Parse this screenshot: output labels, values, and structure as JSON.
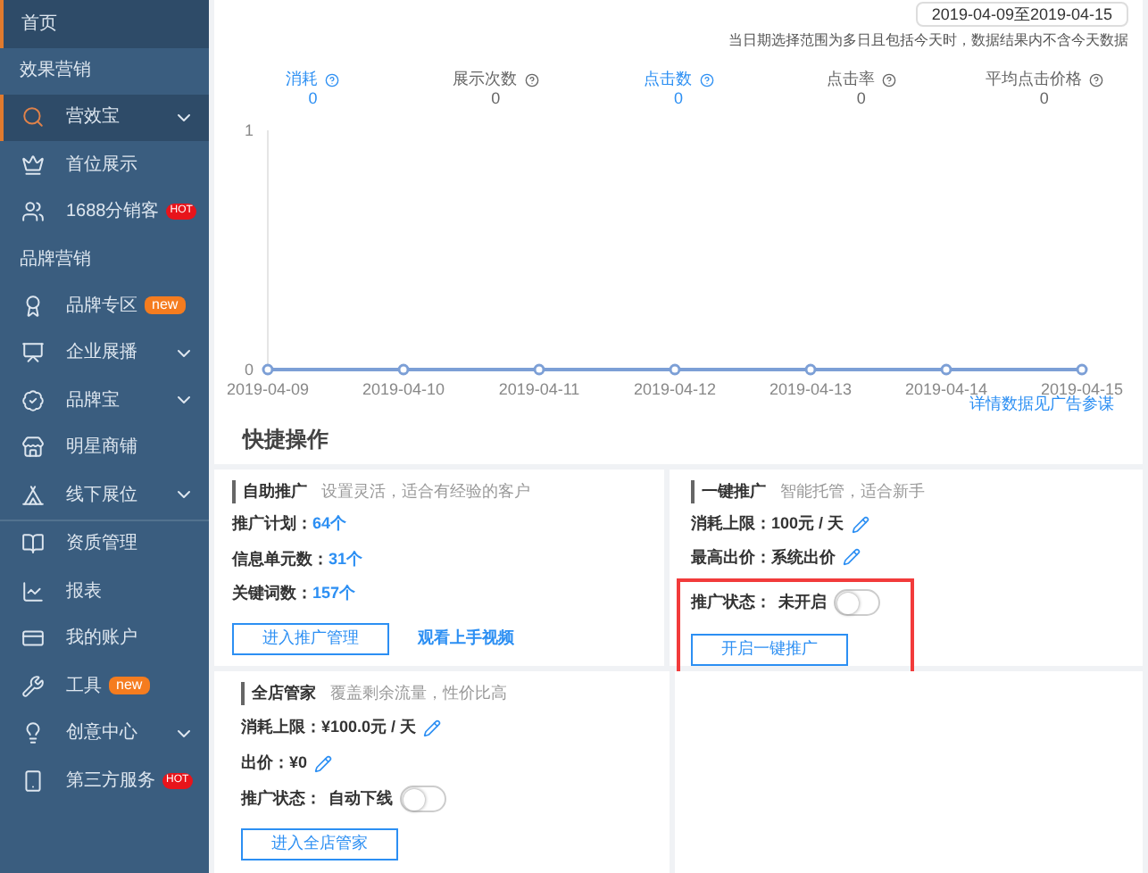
{
  "sidebar": {
    "items": [
      {
        "kind": "item",
        "label": "首页",
        "selected": true
      },
      {
        "kind": "header",
        "label": "效果营销"
      },
      {
        "kind": "item",
        "label": "营效宝",
        "selected": true,
        "submenu": true
      },
      {
        "kind": "item",
        "label": "首位展示",
        "selected": false
      },
      {
        "kind": "item",
        "label": "1688分销客",
        "selected": false,
        "badge": {
          "kind": "hot",
          "text": "HOT"
        }
      },
      {
        "kind": "header",
        "label": "品牌营销"
      },
      {
        "kind": "item",
        "label": "品牌专区",
        "selected": false,
        "badge": {
          "kind": "new",
          "text": "new"
        }
      },
      {
        "kind": "item",
        "label": "企业展播",
        "selected": false,
        "submenu": true
      },
      {
        "kind": "item",
        "label": "品牌宝",
        "selected": false,
        "submenu": true
      },
      {
        "kind": "item",
        "label": "明星商铺",
        "selected": false
      },
      {
        "kind": "item",
        "label": "线下展位",
        "selected": false,
        "submenu": true
      },
      {
        "kind": "divider"
      },
      {
        "kind": "item",
        "label": "资质管理",
        "selected": false
      },
      {
        "kind": "item",
        "label": "报表",
        "selected": false
      },
      {
        "kind": "item",
        "label": "我的账户",
        "selected": false
      },
      {
        "kind": "item",
        "label": "工具",
        "selected": false,
        "badge": {
          "kind": "new",
          "text": "new"
        }
      },
      {
        "kind": "item",
        "label": "创意中心",
        "selected": false,
        "submenu": true
      },
      {
        "kind": "item",
        "label": "第三方服务",
        "selected": false,
        "badge": {
          "kind": "hot",
          "text": "HOT"
        }
      }
    ]
  },
  "date_range": "2019-04-09至2019-04-15",
  "date_note": "当日期选择范围为多日且包括今天时，数据结果内不含今天数据",
  "metrics": [
    {
      "label": "消耗",
      "value": "0",
      "selected": true
    },
    {
      "label": "展示次数",
      "value": "0",
      "selected": false
    },
    {
      "label": "点击数",
      "value": "0",
      "selected": true
    },
    {
      "label": "点击率",
      "value": "0",
      "selected": false
    },
    {
      "label": "平均点击价格",
      "value": "0",
      "selected": false
    }
  ],
  "chart_data": {
    "type": "line",
    "categories": [
      "2019-04-09",
      "2019-04-10",
      "2019-04-11",
      "2019-04-12",
      "2019-04-13",
      "2019-04-14",
      "2019-04-15"
    ],
    "yticks": [
      0,
      1
    ],
    "ylim": [
      0,
      1
    ],
    "series": [
      {
        "color": "#7c9fd6",
        "marker": "circle",
        "values": [
          0,
          0,
          0,
          0,
          0,
          0,
          0
        ]
      }
    ]
  },
  "chart_link": "详情数据见广告参谋",
  "quick_ops": {
    "title": "快捷操作",
    "cards": [
      {
        "title": "自助推广",
        "subtitle": "设置灵活，适合有经验的客户",
        "highlighted": false,
        "fields": [
          {
            "kind": "count",
            "label": "推广计划：",
            "value": "64个"
          },
          {
            "kind": "count",
            "label": "信息单元数：",
            "value": "31个"
          },
          {
            "kind": "count",
            "label": "关键词数：",
            "value": "157个"
          }
        ],
        "button": "进入推广管理",
        "link": "观看上手视频"
      },
      {
        "title": "一键推广",
        "subtitle": "智能托管，适合新手",
        "highlighted": true,
        "fields": [
          {
            "kind": "editable",
            "label": "消耗上限：",
            "value": "100元 / 天"
          },
          {
            "kind": "editable",
            "label": "最高出价：",
            "value": "系统出价"
          },
          {
            "kind": "toggle",
            "label": "推广状态：",
            "value": "未开启",
            "on": false
          }
        ],
        "button": "开启一键推广"
      },
      {
        "title": "全店管家",
        "subtitle": "覆盖剩余流量，性价比高",
        "highlighted": false,
        "fields": [
          {
            "kind": "editable",
            "label": "消耗上限：",
            "value": "¥100.0元 / 天"
          },
          {
            "kind": "editable",
            "label": "出价：",
            "value": "¥0"
          },
          {
            "kind": "toggle",
            "label": "推广状态：",
            "value": "自动下线",
            "on": false
          }
        ],
        "button": "进入全店管家"
      }
    ]
  }
}
